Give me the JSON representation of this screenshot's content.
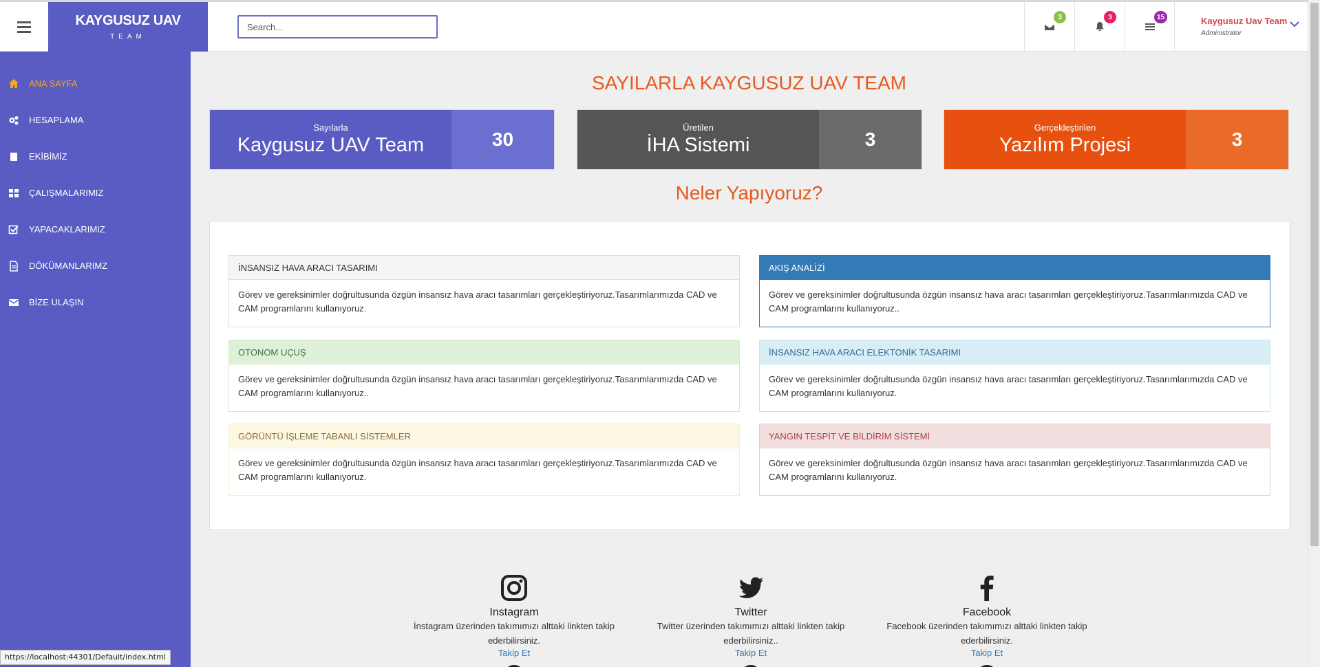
{
  "brand": {
    "title": "KAYGUSUZ UAV",
    "subtitle": "TEAM"
  },
  "search": {
    "placeholder": "Search..."
  },
  "topbar": {
    "mail_badge": "3",
    "bell_badge": "3",
    "tasks_badge": "15",
    "user_name": "Kaygusuz Uav Team",
    "user_role": "Administrator"
  },
  "colors": {
    "brand": "#5a5cc4",
    "accent": "#e55a1f",
    "active_nav": "#f5a623"
  },
  "sidebar": {
    "items": [
      {
        "label": "ANA SAYFA",
        "icon": "home-icon"
      },
      {
        "label": "HESAPLAMA",
        "icon": "gears-icon"
      },
      {
        "label": "EKİBİMİZ",
        "icon": "book-icon"
      },
      {
        "label": "ÇALIŞMALARIMIZ",
        "icon": "grid-icon"
      },
      {
        "label": "YAPACAKLARIMIZ",
        "icon": "checkbox-icon"
      },
      {
        "label": "DÖKÜMANLARIMZ",
        "icon": "document-icon"
      },
      {
        "label": "BİZE ULAŞIN",
        "icon": "envelope-icon"
      }
    ]
  },
  "main": {
    "title": "SAYILARLA KAYGUSUZ UAV TEAM",
    "stats": [
      {
        "small": "Sayılarla",
        "big": "Kaygusuz UAV Team",
        "value": "30"
      },
      {
        "small": "Üretilen",
        "big": "İHA Sistemi",
        "value": "3"
      },
      {
        "small": "Gerçekleştirilen",
        "big": "Yazılım Projesi",
        "value": "3"
      }
    ],
    "subtitle": "Neler Yapıyoruz?",
    "cards": [
      {
        "title": "İNSANSIZ HAVA ARACI TASARIMI",
        "body": "Görev ve gereksinimler doğrultusunda özgün insansız hava aracı tasarımları gerçekleştiriyoruz.Tasarımlarımızda CAD ve CAM programlarını kullanıyoruz."
      },
      {
        "title": "AKIŞ ANALİZİ",
        "body": "Görev ve gereksinimler doğrultusunda özgün insansız hava aracı tasarımları gerçekleştiriyoruz.Tasarımlarımızda CAD ve CAM programlarını kullanıyoruz.."
      },
      {
        "title": "OTONOM UÇUŞ",
        "body": "Görev ve gereksinimler doğrultusunda özgün insansız hava aracı tasarımları gerçekleştiriyoruz.Tasarımlarımızda CAD ve CAM programlarını kullanıyoruz.."
      },
      {
        "title": "İNSANSIZ HAVA ARACI ELEKTONİK TASARIMI",
        "body": "Görev ve gereksinimler doğrultusunda özgün insansız hava aracı tasarımları gerçekleştiriyoruz.Tasarımlarımızda CAD ve CAM programlarını kullanıyoruz."
      },
      {
        "title": "GÖRÜNTÜ İŞLEME TABANLI SİSTEMLER",
        "body": "Görev ve gereksinimler doğrultusunda özgün insansız hava aracı tasarımları gerçekleştiriyoruz.Tasarımlarımızda CAD ve CAM programlarını kullanıyoruz."
      },
      {
        "title": "YANGIN TESPİT VE BİLDİRİM SİSTEMİ",
        "body": "Görev ve gereksinimler doğrultusunda özgün insansız hava aracı tasarımları gerçekleştiriyoruz.Tasarımlarımızda CAD ve CAM programlarını kullanıyoruz."
      }
    ],
    "social": [
      {
        "name": "Instagram",
        "icon": "instagram-icon",
        "desc": "İnstagram üzerinden takımımızı alttaki linkten takip ederbilirsiniz.",
        "link": "Takip Et"
      },
      {
        "name": "Twitter",
        "icon": "twitter-icon",
        "desc": "Twitter üzerinden takımımızı alttaki linkten takip ederbilirsiniz..",
        "link": "Takip Et"
      },
      {
        "name": "Facebook",
        "icon": "facebook-icon",
        "desc": "Facebook üzerinden takımımızı alttaki linkten takip ederbilirsiniz.",
        "link": "Takip Et"
      }
    ]
  },
  "statusbar": {
    "url": "https://localhost:44301/Default/index.html"
  }
}
